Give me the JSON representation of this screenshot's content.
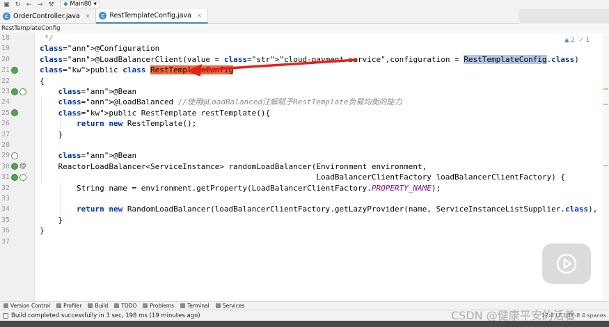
{
  "toolbar": {
    "run_config": "Main80",
    "icons": [
      "save-icon",
      "sync-icon",
      "back-icon",
      "forward-icon",
      "build-icon",
      "run-config-icon"
    ]
  },
  "tabs": [
    {
      "label": "OrderController.java",
      "active": false
    },
    {
      "label": "RestTemplateConfig.java",
      "active": true
    }
  ],
  "breadcrumb": "RestTemplateConfig",
  "editor": {
    "hint_warnings": "▲ 2",
    "hint_ok": "✓ 1",
    "lines": [
      {
        "n": "18",
        "text": " */"
      },
      {
        "n": "19",
        "text": "@Configuration"
      },
      {
        "n": "20",
        "text": "@LoadBalancerClient(value = \"cloud-payment-service\",configuration = RestTemplateConfig.class)"
      },
      {
        "n": "21",
        "text": "public class RestTemplateConfig"
      },
      {
        "n": "22",
        "text": "{"
      },
      {
        "n": "23",
        "text": "    @Bean"
      },
      {
        "n": "24",
        "text": "    @LoadBalanced //使用@LoadBalanced注解赋予RestTemplate负载均衡的能力"
      },
      {
        "n": "25",
        "text": "    public RestTemplate restTemplate(){"
      },
      {
        "n": "26",
        "text": "        return new RestTemplate();"
      },
      {
        "n": "27",
        "text": "    }"
      },
      {
        "n": "28",
        "text": ""
      },
      {
        "n": "29",
        "text": "    @Bean"
      },
      {
        "n": "30",
        "text": "    ReactorLoadBalancer<ServiceInstance> randomLoadBalancer(Environment environment,"
      },
      {
        "n": "31",
        "text": "                                                            LoadBalancerClientFactory loadBalancerClientFactory) {"
      },
      {
        "n": "32",
        "text": "        String name = environment.getProperty(LoadBalancerClientFactory.PROPERTY_NAME);"
      },
      {
        "n": "33",
        "text": ""
      },
      {
        "n": "34",
        "text": "        return new RandomLoadBalancer(loadBalancerClientFactory.getLazyProvider(name, ServiceInstanceListSupplier.class),"
      },
      {
        "n": "35",
        "text": "    }"
      },
      {
        "n": "36",
        "text": "}"
      },
      {
        "n": "37",
        "text": ""
      }
    ]
  },
  "bottom_tabs": [
    "Version Control",
    "Profiler",
    "Build",
    "TODO",
    "Problems",
    "Terminal",
    "Services"
  ],
  "status": {
    "message": "Build completed successfully in 3 sec, 198 ms (19 minutes ago)",
    "right": "12:8 LF  UTF-8  4 spaces"
  },
  "watermark": "CSDN @健康平安的活着",
  "colors": {
    "keyword": "#0033b3",
    "annotation": "#808000",
    "string": "#067d17",
    "comment": "#8c8c8c",
    "constant": "#871094",
    "selection_blue": "#b3c5e8",
    "highlight_red": "#ef6a3a",
    "arrow_red": "#e8201a",
    "tab_accent": "#4083c9"
  }
}
